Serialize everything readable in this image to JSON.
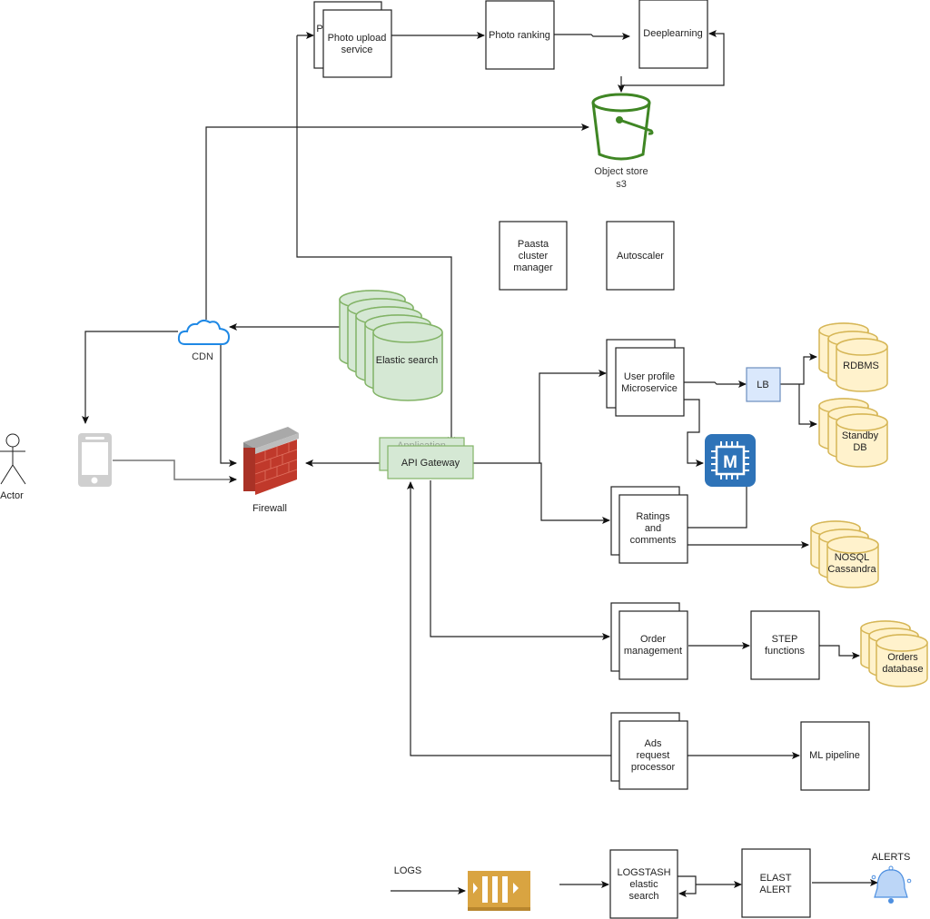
{
  "diagram": {
    "nodes": {
      "photo_upload": {
        "line1": "Photo upload",
        "line2": "service",
        "back_hint": "P"
      },
      "photo_ranking": {
        "label": "Photo ranking"
      },
      "deeplearning": {
        "label": "Deeplearning"
      },
      "object_store": {
        "line1": "Object store",
        "line2": "s3"
      },
      "paasta": {
        "line1": "Paasta",
        "line2": "cluster",
        "line3": "manager"
      },
      "autoscaler": {
        "label": "Autoscaler"
      },
      "cdn": {
        "label": "CDN"
      },
      "elastic_search": {
        "label": "Elastic search"
      },
      "actor": {
        "label": "Actor"
      },
      "firewall": {
        "label": "Firewall"
      },
      "api_gateway": {
        "label": "API Gateway",
        "back_label": "Application"
      },
      "user_profile": {
        "line1": "User profile",
        "line2": "Microservice"
      },
      "lb": {
        "label": "LB"
      },
      "rdbms": {
        "label": "RDBMS"
      },
      "standby_db": {
        "line1": "Standby",
        "line2": "DB"
      },
      "memcache": {
        "label": "M"
      },
      "ratings": {
        "line1": "Ratings",
        "line2": "and",
        "line3": "comments"
      },
      "nosql": {
        "line1": "NOSQL",
        "line2": "Cassandra"
      },
      "order_mgmt": {
        "line1": "Order",
        "line2": "management"
      },
      "step_functions": {
        "line1": "STEP",
        "line2": "functions"
      },
      "orders_db": {
        "line1": "Orders",
        "line2": "database"
      },
      "ads_processor": {
        "line1": "Ads",
        "line2": "request",
        "line3": "processor"
      },
      "ml_pipeline": {
        "label": "ML pipeline"
      },
      "logs": {
        "label": "LOGS"
      },
      "logstash": {
        "line1": "LOGSTASH",
        "line2": "elastic",
        "line3": "search"
      },
      "elast_alert": {
        "line1": "ELAST",
        "line2": "ALERT"
      },
      "alerts": {
        "label": "ALERTS"
      }
    },
    "colors": {
      "green_fill": "#d5e8d4",
      "green_stroke": "#82b366",
      "yellow_fill": "#fff2cc",
      "yellow_stroke": "#d6b656",
      "blue_fill": "#dae8fc",
      "blue_stroke": "#6c8ebf",
      "s3_green": "#3f8624",
      "cdn_blue": "#1e88e5",
      "memcache_blue": "#2e73b8",
      "queue_gold": "#d9a441",
      "firewall_red": "#c0392b"
    }
  }
}
